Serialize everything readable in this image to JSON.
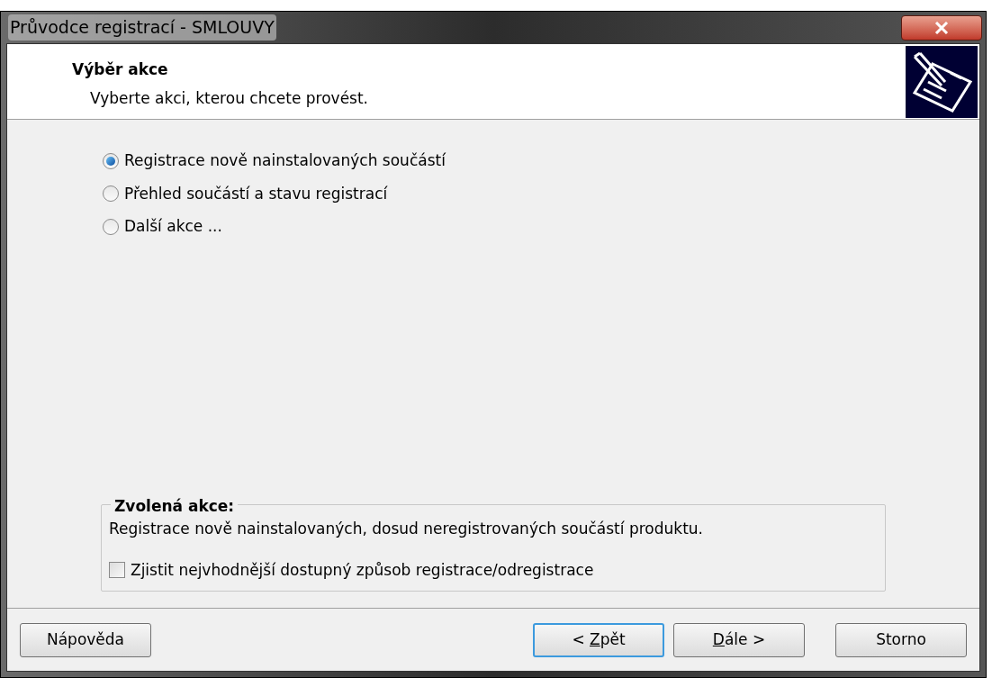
{
  "window": {
    "title": "Průvodce registrací - SMLOUVY"
  },
  "header": {
    "title": "Výběr akce",
    "subtitle": "Vyberte akci, kterou chcete provést."
  },
  "options": [
    {
      "label": "Registrace nově nainstalovaných součástí",
      "selected": true
    },
    {
      "label": "Přehled součástí a stavu registrací",
      "selected": false
    },
    {
      "label": "Další akce ...",
      "selected": false
    }
  ],
  "group": {
    "title": "Zvolená akce:",
    "description": "Registrace nově nainstalovaných, dosud neregistrovaných součástí produktu.",
    "checkbox": {
      "label": "Zjistit nejvhodnější dostupný způsob registrace/odregistrace",
      "checked": false
    }
  },
  "buttons": [
    {
      "pre": "Nápověda",
      "focused": false
    },
    {
      "pre": "< ",
      "key": "Z",
      "post": "pět",
      "focused": true
    },
    {
      "key": "D",
      "post": "ále >",
      "focused": false
    },
    {
      "pre": "Storno",
      "focused": false
    }
  ]
}
